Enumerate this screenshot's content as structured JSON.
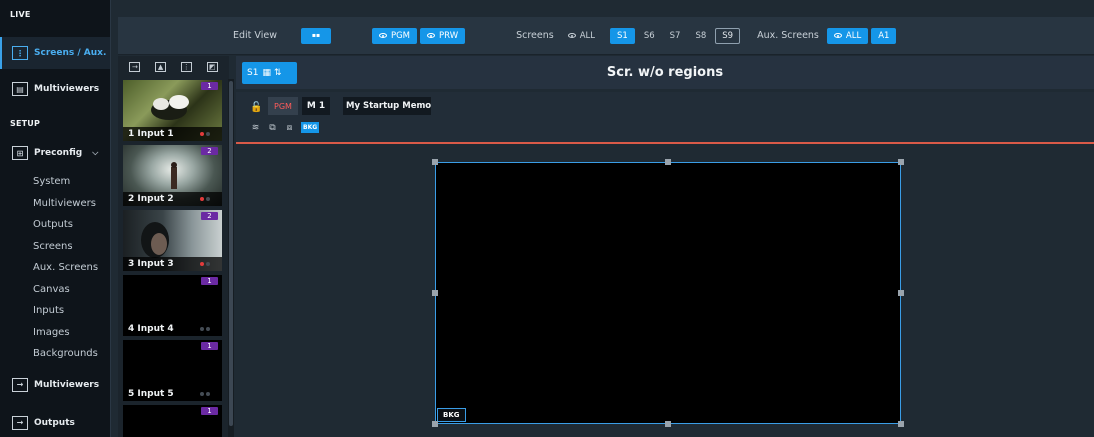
{
  "sidebar": {
    "live_header": "LIVE",
    "setup_header": "SETUP",
    "items_live": [
      {
        "label": "Screens / Aux.",
        "icon": "screens-icon",
        "active": true
      },
      {
        "label": "Multiviewers",
        "icon": "multiviewer-icon",
        "active": false
      }
    ],
    "preconfig": {
      "label": "Preconfig",
      "icon": "preconfig-icon",
      "chevron": "chevron-down-icon"
    },
    "sub_items": [
      "System",
      "Multiviewers",
      "Outputs",
      "Screens",
      "Aux. Screens",
      "Canvas",
      "Inputs",
      "Images",
      "Backgrounds"
    ],
    "bottom_items": [
      {
        "label": "Multiviewers",
        "icon": "arrow-right-box-icon"
      },
      {
        "label": "Outputs",
        "icon": "arrow-right-box-icon"
      }
    ]
  },
  "toolbar": {
    "edit_view_label": "Edit View",
    "edit_view_btn": "▪▪",
    "pgm_label": "PGM",
    "prw_label": "PRW",
    "screens_label": "Screens",
    "screens_all": "ALL",
    "screens": [
      "S1",
      "S6",
      "S7",
      "S8",
      "S9"
    ],
    "active_screen": "S1",
    "outlined_screen": "S9",
    "aux_label": "Aux. Screens",
    "aux_all": "ALL",
    "aux_screens": [
      "A1"
    ],
    "accent_color": "#1596e8"
  },
  "inputs": [
    {
      "number": "1",
      "label": "1 Input 1",
      "live": true,
      "bg": "photo-butterfly"
    },
    {
      "number": "2",
      "label": "2 Input 2",
      "live": true,
      "bg": "photo-explosion"
    },
    {
      "number": "2",
      "label": "3 Input 3",
      "live": true,
      "bg": "photo-portrait"
    },
    {
      "number": "1",
      "label": "4 Input 4",
      "live": false,
      "bg": "black"
    },
    {
      "number": "1",
      "label": "5 Input 5",
      "live": false,
      "bg": "black"
    },
    {
      "number": "1",
      "label": "",
      "live": false,
      "bg": "black"
    }
  ],
  "editor": {
    "screen_selector": "S1",
    "title": "Scr. w/o regions",
    "pgm": "PGM",
    "memory_number": "M 1",
    "memory_name": "My Startup Memor",
    "bkg_chip": "BKG",
    "canvas_tag": "BKG",
    "pgm_color": "#d95a48"
  }
}
